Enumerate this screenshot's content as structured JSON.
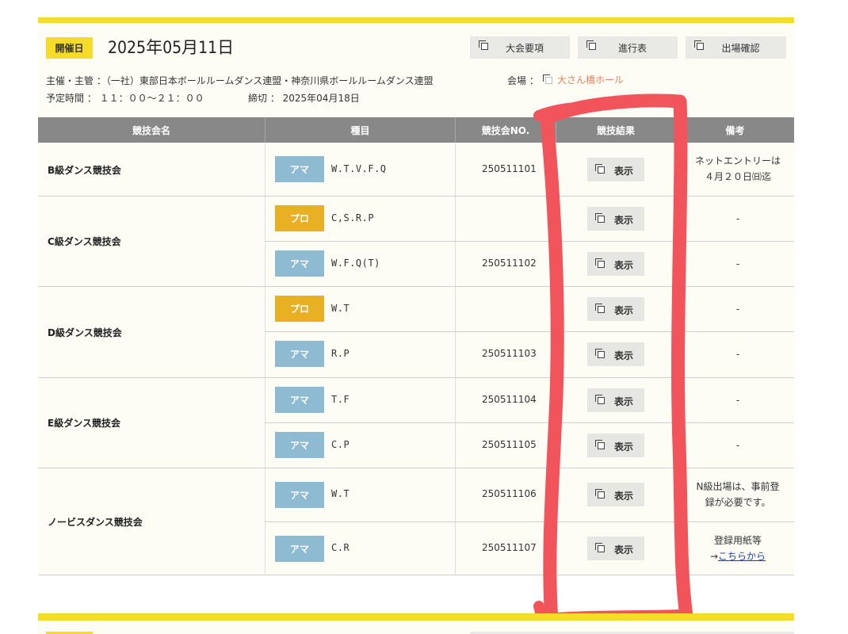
{
  "event": {
    "date_label": "開催日",
    "date": "2025年05月11日",
    "buttons": [
      "大会要項",
      "進行表",
      "出場確認"
    ],
    "organizer": "主催・主管 ：（一社）東部日本ボールルームダンス連盟・神奈川県ボールルームダンス連盟",
    "venue_label": "会場 ：",
    "venue": "大さん橋ホール",
    "time": "予定時間 ： １１：００～２１：００",
    "deadline": "締切 ： 2025年04月18日"
  },
  "table": {
    "headers": [
      "競技会名",
      "種目",
      "競技会NO.",
      "競技結果",
      "備考"
    ],
    "show_label": "表示",
    "groups": [
      {
        "name": "B級ダンス競技会",
        "note": [
          "ネットエントリーは",
          "４月２０日㈰迄"
        ],
        "rows": [
          {
            "type": "アマ",
            "category": "W.T.V.F.Q",
            "no": "250511101"
          }
        ]
      },
      {
        "name": "C級ダンス競技会",
        "rows": [
          {
            "type": "プロ",
            "category": "C,S.R.P",
            "no": "",
            "note": "-"
          },
          {
            "type": "アマ",
            "category": "W.F.Q(T)",
            "no": "250511102",
            "note": "-"
          }
        ]
      },
      {
        "name": "D級ダンス競技会",
        "rows": [
          {
            "type": "プロ",
            "category": "W.T",
            "no": "",
            "note": "-"
          },
          {
            "type": "アマ",
            "category": "R.P",
            "no": "250511103",
            "note": "-"
          }
        ]
      },
      {
        "name": "E級ダンス競技会",
        "rows": [
          {
            "type": "アマ",
            "category": "T.F",
            "no": "250511104",
            "note": "-"
          },
          {
            "type": "アマ",
            "category": "C.P",
            "no": "250511105",
            "note": "-"
          }
        ]
      },
      {
        "name": "ノービスダンス競技会",
        "notes": [
          [
            "N級出場は、事前登",
            "録が必要です。"
          ],
          [
            "登録用紙等"
          ]
        ],
        "link_prefix": "→",
        "link_text": "こちらから",
        "rows": [
          {
            "type": "アマ",
            "category": "W.T",
            "no": "250511106"
          },
          {
            "type": "アマ",
            "category": "C.R",
            "no": "250511107"
          }
        ]
      }
    ]
  },
  "colors": {
    "accent_yellow": "#f5dc2a",
    "ama": "#8ebad2",
    "pro": "#e9b023",
    "annotation_red": "#f2545b"
  }
}
